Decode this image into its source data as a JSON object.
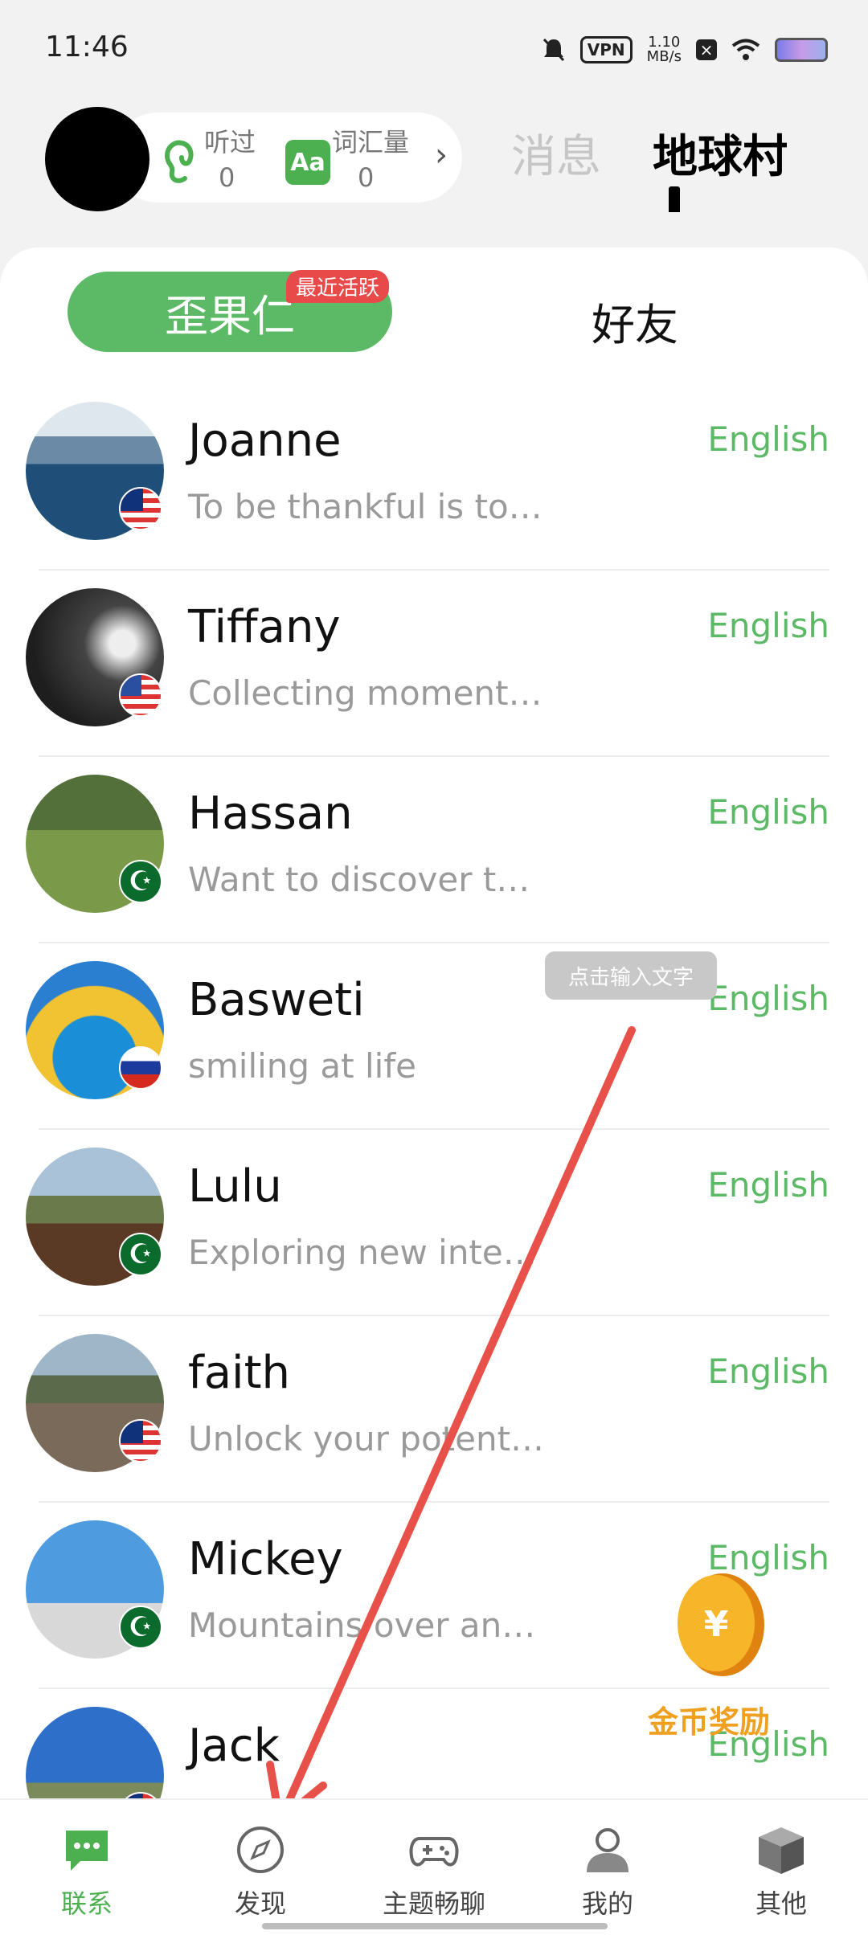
{
  "status_bar": {
    "time": "11:46",
    "vpn": "VPN",
    "speed": "1.10",
    "speed_unit": "MB/s"
  },
  "header": {
    "stats": [
      {
        "label": "听过",
        "value": "0",
        "icon": "ear-icon"
      },
      {
        "label": "词汇量",
        "value": "0",
        "icon": "aa-icon",
        "icon_text": "Aa"
      }
    ],
    "tabs": [
      {
        "label": "消息"
      },
      {
        "label": "地球村",
        "active": true
      }
    ]
  },
  "segments": {
    "left": "歪果仁",
    "badge": "最近活跃",
    "right": "好友"
  },
  "users": [
    {
      "name": "Joanne",
      "bio": "To be thankful is to…",
      "lang": "English",
      "flag": "my"
    },
    {
      "name": "Tiffany",
      "bio": "Collecting moment…",
      "lang": "English",
      "flag": "us"
    },
    {
      "name": "Hassan",
      "bio": "Want to discover t…",
      "lang": "English",
      "flag": "pk"
    },
    {
      "name": "Basweti",
      "bio": "smiling at life",
      "lang": "English",
      "flag": "np"
    },
    {
      "name": "Lulu",
      "bio": "Exploring new inte…",
      "lang": "English",
      "flag": "pk"
    },
    {
      "name": "faith",
      "bio": "Unlock your potent…",
      "lang": "English",
      "flag": "my"
    },
    {
      "name": "Mickey",
      "bio": "Mountains over an…",
      "lang": "English",
      "flag": "pk"
    },
    {
      "name": "Jack",
      "bio": "",
      "lang": "English",
      "flag": "my"
    }
  ],
  "tooltip": "点击输入文字",
  "coin_reward": "金币奖励",
  "nav": [
    {
      "label": "联系",
      "icon": "chat-icon",
      "active": true
    },
    {
      "label": "发现",
      "icon": "compass-icon"
    },
    {
      "label": "主题畅聊",
      "icon": "gamepad-icon"
    },
    {
      "label": "我的",
      "icon": "person-icon"
    },
    {
      "label": "其他",
      "icon": "box-icon"
    }
  ],
  "colors": {
    "accent": "#5cb966",
    "badge": "#e84a4a",
    "arrow": "#e8504a",
    "coin": "#f0a020"
  }
}
